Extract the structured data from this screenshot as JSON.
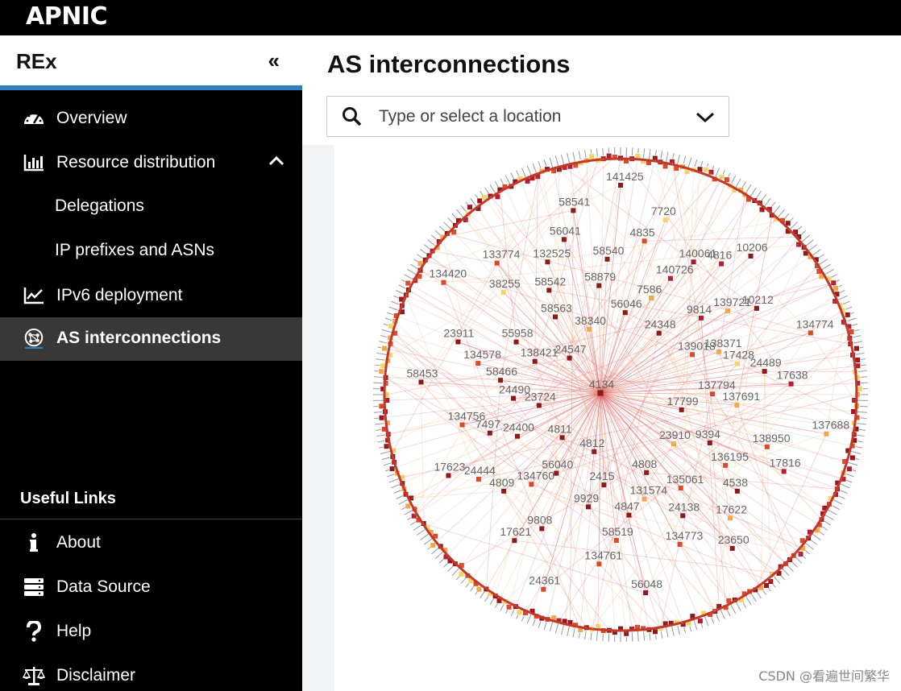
{
  "header": {
    "brand_bold": "APNIC"
  },
  "sidebar": {
    "title": "REx",
    "collapse_glyph": "«",
    "items": [
      {
        "label": "Overview",
        "icon": "gauge-icon"
      },
      {
        "label": "Resource distribution",
        "icon": "bar-chart-icon",
        "expanded": true
      },
      {
        "label": "Delegations"
      },
      {
        "label": "IP prefixes and ASNs"
      },
      {
        "label": "IPv6 deployment",
        "icon": "line-chart-icon"
      },
      {
        "label": "AS interconnections",
        "icon": "network-icon",
        "active": true
      }
    ],
    "useful_links_heading": "Useful Links",
    "links": [
      {
        "label": "About",
        "icon": "info-icon"
      },
      {
        "label": "Data Source",
        "icon": "server-icon"
      },
      {
        "label": "Help",
        "icon": "question-icon"
      },
      {
        "label": "Disclaimer",
        "icon": "scales-icon"
      }
    ]
  },
  "main": {
    "title": "AS interconnections",
    "search": {
      "placeholder": "Type or select a location"
    }
  },
  "graph": {
    "center_node": "4134",
    "inner_nodes": [
      {
        "label": "141425",
        "c": "#8b1a1a"
      },
      {
        "label": "4835",
        "c": "#d94a2a"
      },
      {
        "label": "7586",
        "c": "#f3a64a"
      },
      {
        "label": "7720",
        "c": "#f6d36a"
      },
      {
        "label": "140726",
        "c": "#b21f2d"
      },
      {
        "label": "24348",
        "c": "#8b1a1a"
      },
      {
        "label": "140061",
        "c": "#9b1b30"
      },
      {
        "label": "4816",
        "c": "#b21f2d"
      },
      {
        "label": "9814",
        "c": "#b21f2d"
      },
      {
        "label": "10206",
        "c": "#8b1a1a"
      },
      {
        "label": "139721",
        "c": "#f3a64a"
      },
      {
        "label": "139018",
        "c": "#d94a2a"
      },
      {
        "label": "10212",
        "c": "#8b1a1a"
      },
      {
        "label": "138371",
        "c": "#f3a64a"
      },
      {
        "label": "17428",
        "c": "#f6d36a"
      },
      {
        "label": "134774",
        "c": "#d94a2a"
      },
      {
        "label": "24489",
        "c": "#8b1a1a"
      },
      {
        "label": "137794",
        "c": "#d94a2a"
      },
      {
        "label": "17638",
        "c": "#b21f2d"
      },
      {
        "label": "137691",
        "c": "#f3a64a"
      },
      {
        "label": "17799",
        "c": "#8b1a1a"
      },
      {
        "label": "137688",
        "c": "#f3a64a"
      },
      {
        "label": "138950",
        "c": "#d94a2a"
      },
      {
        "label": "9394",
        "c": "#8b1a1a"
      },
      {
        "label": "17816",
        "c": "#b21f2d"
      },
      {
        "label": "136195",
        "c": "#d94a2a"
      },
      {
        "label": "23910",
        "c": "#f3a64a"
      },
      {
        "label": "4538",
        "c": "#8b1a1a"
      },
      {
        "label": "17622",
        "c": "#f3a64a"
      },
      {
        "label": "135061",
        "c": "#d94a2a"
      },
      {
        "label": "23650",
        "c": "#8b1a1a"
      },
      {
        "label": "24138",
        "c": "#8b1a1a"
      },
      {
        "label": "4808",
        "c": "#8b1a1a"
      },
      {
        "label": "134773",
        "c": "#d94a2a"
      },
      {
        "label": "131574",
        "c": "#f3a64a"
      },
      {
        "label": "4847",
        "c": "#8b1a1a"
      },
      {
        "label": "56048",
        "c": "#8b1a1a"
      },
      {
        "label": "58519",
        "c": "#d94a2a"
      },
      {
        "label": "2415",
        "c": "#8b1a1a"
      },
      {
        "label": "134761",
        "c": "#d94a2a"
      },
      {
        "label": "9929",
        "c": "#8b1a1a"
      },
      {
        "label": "4812",
        "c": "#8b1a1a"
      },
      {
        "label": "24361",
        "c": "#d94a2a"
      },
      {
        "label": "9808",
        "c": "#8b1a1a"
      },
      {
        "label": "56040",
        "c": "#8b1a1a"
      },
      {
        "label": "17621",
        "c": "#8b1a1a"
      },
      {
        "label": "134760",
        "c": "#d94a2a"
      },
      {
        "label": "4811",
        "c": "#8b1a1a"
      },
      {
        "label": "4809",
        "c": "#8b1a1a"
      },
      {
        "label": "24444",
        "c": "#d94a2a"
      },
      {
        "label": "24400",
        "c": "#8b1a1a"
      },
      {
        "label": "17623",
        "c": "#8b1a1a"
      },
      {
        "label": "7497",
        "c": "#8b1a1a"
      },
      {
        "label": "23724",
        "c": "#8b1a1a"
      },
      {
        "label": "134756",
        "c": "#d94a2a"
      },
      {
        "label": "24490",
        "c": "#8b1a1a"
      },
      {
        "label": "58466",
        "c": "#8b1a1a"
      },
      {
        "label": "58453",
        "c": "#8b1a1a"
      },
      {
        "label": "134578",
        "c": "#d94a2a"
      },
      {
        "label": "138421",
        "c": "#8b1a1a"
      },
      {
        "label": "23911",
        "c": "#8b1a1a"
      },
      {
        "label": "55958",
        "c": "#8b1a1a"
      },
      {
        "label": "24547",
        "c": "#8b1a1a"
      },
      {
        "label": "134420",
        "c": "#d94a2a"
      },
      {
        "label": "38255",
        "c": "#f6d36a"
      },
      {
        "label": "58563",
        "c": "#8b1a1a"
      },
      {
        "label": "133774",
        "c": "#d94a2a"
      },
      {
        "label": "58542",
        "c": "#8b1a1a"
      },
      {
        "label": "38340",
        "c": "#f3a64a"
      },
      {
        "label": "132525",
        "c": "#8b1a1a"
      },
      {
        "label": "56041",
        "c": "#8b1a1a"
      },
      {
        "label": "58879",
        "c": "#8b1a1a"
      },
      {
        "label": "58541",
        "c": "#8b1a1a"
      },
      {
        "label": "58540",
        "c": "#8b1a1a"
      },
      {
        "label": "56046",
        "c": "#8b1a1a"
      }
    ]
  },
  "watermark": "CSDN @看遍世间繁华",
  "colors": {
    "accent": "#2f7fc1",
    "sidebar_bg": "#000000",
    "active_bg": "#383838",
    "edge": "#e06a6a"
  }
}
